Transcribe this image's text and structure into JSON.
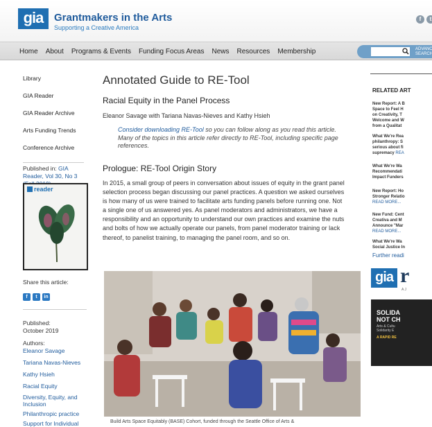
{
  "header": {
    "logo": "gia",
    "site_title": "Grantmakers in the Arts",
    "tagline": "Supporting a Creative America"
  },
  "nav": {
    "items": [
      "Home",
      "About",
      "Programs & Events",
      "Funding Focus Areas",
      "News",
      "Resources",
      "Membership"
    ],
    "search_value": "",
    "advanced_search": "ADVANCED SEARCH"
  },
  "sidebar": {
    "links": [
      "Library",
      "GIA Reader",
      "GIA Reader Archive",
      "Arts Funding Trends",
      "Conference Archive"
    ],
    "published_in_label": "Published in:",
    "published_in_link": "GIA Reader, Vol 30, No 3 (Fall 2019)",
    "cover_title": "reader",
    "share_label": "Share this article:",
    "share_icons": [
      "f",
      "t",
      "in"
    ],
    "published_label": "Published:",
    "published_date": "October 2019",
    "authors_label": "Authors:",
    "tags": [
      "Eleanor Savage",
      "Tariana Navas-Nieves",
      "Kathy Hsieh",
      "Racial Equity",
      "Diversity, Equity, and Inclusion",
      "Philanthropic practice",
      "Support for Individual Artists"
    ]
  },
  "article": {
    "title": "Annotated Guide to RE-Tool",
    "subtitle": "Racial Equity in the Panel Process",
    "authors": "Eleanor Savage with Tariana Navas-Nieves and Kathy Hsieh",
    "note_link": "Consider downloading RE-Tool",
    "note_rest": " so you can follow along as you read this article. Many of the topics in this article refer directly to RE-Tool, including specific page references.",
    "section_heading": "Prologue: RE-Tool Origin Story",
    "body": "In 2015, a small group of peers in conversation about issues of equity in the grant panel selection process began discussing our panel practices. A question we asked ourselves is how many of us were trained to facilitate arts funding panels before running one. Not a single one of us answered yes. As panel moderators and administrators, we have a responsibility and an opportunity to understand our own practices and examine the nuts and bolts of how we actually operate our panels, from panel moderator training or lack thereof, to panelist training, to managing the panel room, and so on.",
    "caption": "Build Arts Space Equitably (BASE) Cohort, funded through the Seattle Office of Arts &"
  },
  "right": {
    "related_heading": "RELATED ART",
    "items": [
      {
        "text": "New Report: A B\nSpace to Feel H\non Creativity, T\nWelcome and W\nfrom a Qualitat",
        "more": ""
      },
      {
        "text": "What We're Rea\nphilanthropy: S\nserious about fi\nsupremacy",
        "more": "REA"
      },
      {
        "text": "What We're Wa\nRecommendati\nImpact Funders",
        "more": ""
      },
      {
        "text": "New Report: Ho\nStronger Relatio",
        "more": "READ MORE..."
      },
      {
        "text": "New Fund: Cent\nCreativa and M\nAnnounce \"Mar",
        "more": "READ MORE..."
      },
      {
        "text": "What We're Wa\nSocial Justice In",
        "more": ""
      }
    ],
    "further_reading": "Further readi",
    "gia_logo": "gia",
    "gia_r": "r",
    "gia_small": "A J",
    "sol_title": "SOLIDA\nNOT CH",
    "sol_sub": "Arts & Cultu\nSolidarity E",
    "sol_rapid": "A RAPID RE"
  }
}
